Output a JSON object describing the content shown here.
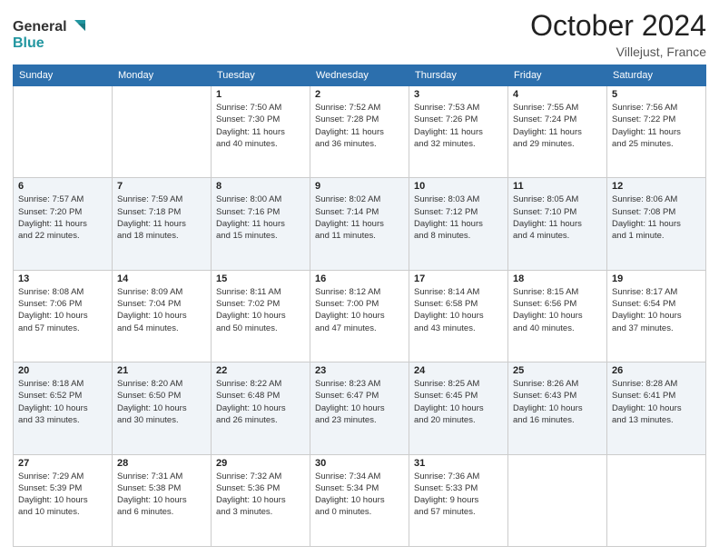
{
  "logo": {
    "line1": "General",
    "line2": "Blue"
  },
  "title": "October 2024",
  "location": "Villejust, France",
  "weekdays": [
    "Sunday",
    "Monday",
    "Tuesday",
    "Wednesday",
    "Thursday",
    "Friday",
    "Saturday"
  ],
  "weeks": [
    [
      {
        "day": "",
        "info": ""
      },
      {
        "day": "",
        "info": ""
      },
      {
        "day": "1",
        "info": "Sunrise: 7:50 AM\nSunset: 7:30 PM\nDaylight: 11 hours\nand 40 minutes."
      },
      {
        "day": "2",
        "info": "Sunrise: 7:52 AM\nSunset: 7:28 PM\nDaylight: 11 hours\nand 36 minutes."
      },
      {
        "day": "3",
        "info": "Sunrise: 7:53 AM\nSunset: 7:26 PM\nDaylight: 11 hours\nand 32 minutes."
      },
      {
        "day": "4",
        "info": "Sunrise: 7:55 AM\nSunset: 7:24 PM\nDaylight: 11 hours\nand 29 minutes."
      },
      {
        "day": "5",
        "info": "Sunrise: 7:56 AM\nSunset: 7:22 PM\nDaylight: 11 hours\nand 25 minutes."
      }
    ],
    [
      {
        "day": "6",
        "info": "Sunrise: 7:57 AM\nSunset: 7:20 PM\nDaylight: 11 hours\nand 22 minutes."
      },
      {
        "day": "7",
        "info": "Sunrise: 7:59 AM\nSunset: 7:18 PM\nDaylight: 11 hours\nand 18 minutes."
      },
      {
        "day": "8",
        "info": "Sunrise: 8:00 AM\nSunset: 7:16 PM\nDaylight: 11 hours\nand 15 minutes."
      },
      {
        "day": "9",
        "info": "Sunrise: 8:02 AM\nSunset: 7:14 PM\nDaylight: 11 hours\nand 11 minutes."
      },
      {
        "day": "10",
        "info": "Sunrise: 8:03 AM\nSunset: 7:12 PM\nDaylight: 11 hours\nand 8 minutes."
      },
      {
        "day": "11",
        "info": "Sunrise: 8:05 AM\nSunset: 7:10 PM\nDaylight: 11 hours\nand 4 minutes."
      },
      {
        "day": "12",
        "info": "Sunrise: 8:06 AM\nSunset: 7:08 PM\nDaylight: 11 hours\nand 1 minute."
      }
    ],
    [
      {
        "day": "13",
        "info": "Sunrise: 8:08 AM\nSunset: 7:06 PM\nDaylight: 10 hours\nand 57 minutes."
      },
      {
        "day": "14",
        "info": "Sunrise: 8:09 AM\nSunset: 7:04 PM\nDaylight: 10 hours\nand 54 minutes."
      },
      {
        "day": "15",
        "info": "Sunrise: 8:11 AM\nSunset: 7:02 PM\nDaylight: 10 hours\nand 50 minutes."
      },
      {
        "day": "16",
        "info": "Sunrise: 8:12 AM\nSunset: 7:00 PM\nDaylight: 10 hours\nand 47 minutes."
      },
      {
        "day": "17",
        "info": "Sunrise: 8:14 AM\nSunset: 6:58 PM\nDaylight: 10 hours\nand 43 minutes."
      },
      {
        "day": "18",
        "info": "Sunrise: 8:15 AM\nSunset: 6:56 PM\nDaylight: 10 hours\nand 40 minutes."
      },
      {
        "day": "19",
        "info": "Sunrise: 8:17 AM\nSunset: 6:54 PM\nDaylight: 10 hours\nand 37 minutes."
      }
    ],
    [
      {
        "day": "20",
        "info": "Sunrise: 8:18 AM\nSunset: 6:52 PM\nDaylight: 10 hours\nand 33 minutes."
      },
      {
        "day": "21",
        "info": "Sunrise: 8:20 AM\nSunset: 6:50 PM\nDaylight: 10 hours\nand 30 minutes."
      },
      {
        "day": "22",
        "info": "Sunrise: 8:22 AM\nSunset: 6:48 PM\nDaylight: 10 hours\nand 26 minutes."
      },
      {
        "day": "23",
        "info": "Sunrise: 8:23 AM\nSunset: 6:47 PM\nDaylight: 10 hours\nand 23 minutes."
      },
      {
        "day": "24",
        "info": "Sunrise: 8:25 AM\nSunset: 6:45 PM\nDaylight: 10 hours\nand 20 minutes."
      },
      {
        "day": "25",
        "info": "Sunrise: 8:26 AM\nSunset: 6:43 PM\nDaylight: 10 hours\nand 16 minutes."
      },
      {
        "day": "26",
        "info": "Sunrise: 8:28 AM\nSunset: 6:41 PM\nDaylight: 10 hours\nand 13 minutes."
      }
    ],
    [
      {
        "day": "27",
        "info": "Sunrise: 7:29 AM\nSunset: 5:39 PM\nDaylight: 10 hours\nand 10 minutes."
      },
      {
        "day": "28",
        "info": "Sunrise: 7:31 AM\nSunset: 5:38 PM\nDaylight: 10 hours\nand 6 minutes."
      },
      {
        "day": "29",
        "info": "Sunrise: 7:32 AM\nSunset: 5:36 PM\nDaylight: 10 hours\nand 3 minutes."
      },
      {
        "day": "30",
        "info": "Sunrise: 7:34 AM\nSunset: 5:34 PM\nDaylight: 10 hours\nand 0 minutes."
      },
      {
        "day": "31",
        "info": "Sunrise: 7:36 AM\nSunset: 5:33 PM\nDaylight: 9 hours\nand 57 minutes."
      },
      {
        "day": "",
        "info": ""
      },
      {
        "day": "",
        "info": ""
      }
    ]
  ]
}
